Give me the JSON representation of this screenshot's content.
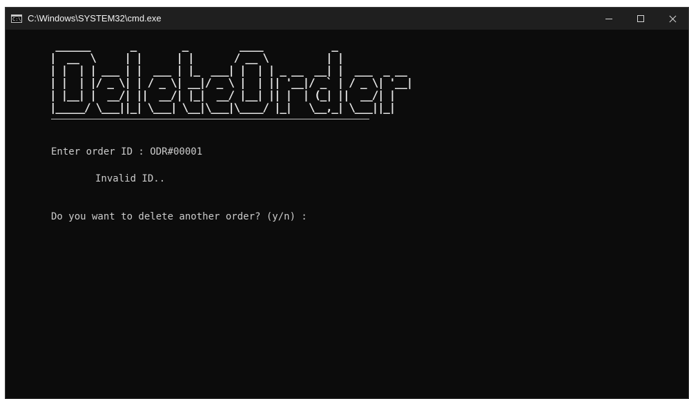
{
  "window": {
    "title": "C:\\Windows\\SYSTEM32\\cmd.exe",
    "icon_glyph": "C:\\"
  },
  "console": {
    "banner": " ______       _        _         ____            _\n|  __  \\     | |      | |       / __ \\          | |\n| |  | | ___ | |  ___ | |_  ___| |  | | _ __  __| |  ___  _ __\n| |  | |/ _ \\| | / _ \\| __|/ _ \\ |  | || '__|/ _` | / _ \\| '__|\n| |__| |  __/| ||  __/| |_|  __/ |__| || |  | (_| ||  __/| |\n|_____/ \\___||_| \\___| \\__|\\___|\\____/ |_|   \\__,_| \\___||_|",
    "lines": {
      "prompt_order_id": "Enter order ID : ODR#00001",
      "error": "Invalid ID..",
      "prompt_again": "Do you want to delete another order? (y/n) :"
    }
  }
}
